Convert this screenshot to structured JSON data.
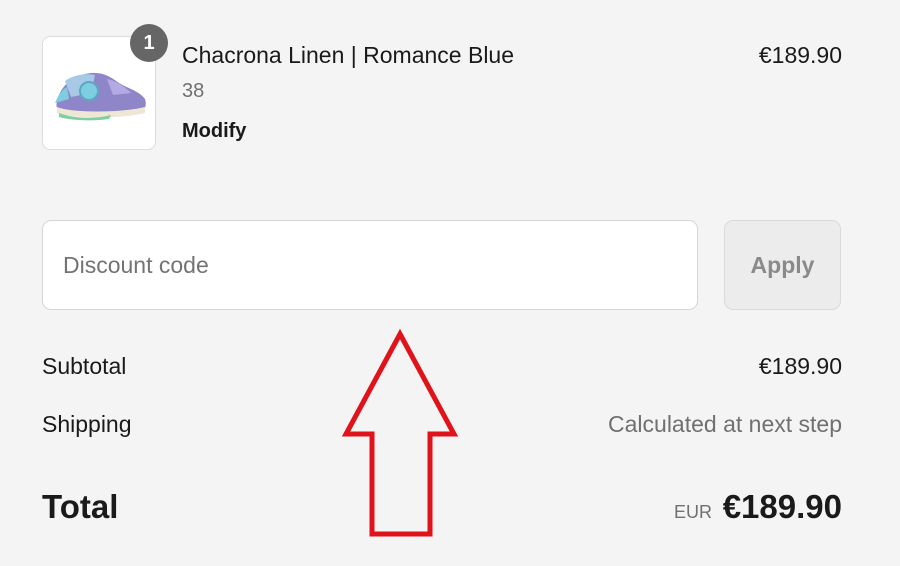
{
  "cart": {
    "item": {
      "quantity": "1",
      "name": "Chacrona Linen | Romance Blue",
      "variant": "38",
      "modify_label": "Modify",
      "price": "€189.90"
    }
  },
  "discount": {
    "placeholder": "Discount code",
    "apply_label": "Apply"
  },
  "summary": {
    "subtotal_label": "Subtotal",
    "subtotal_value": "€189.90",
    "shipping_label": "Shipping",
    "shipping_value": "Calculated at next step",
    "total_label": "Total",
    "total_currency": "EUR",
    "total_value": "€189.90"
  },
  "colors": {
    "background": "#f4f4f4",
    "badge": "#666666",
    "annotation_arrow": "#e0121a"
  },
  "icons": {
    "thumbnail": "sneaker-image",
    "annotation": "red-arrow-up-icon"
  }
}
